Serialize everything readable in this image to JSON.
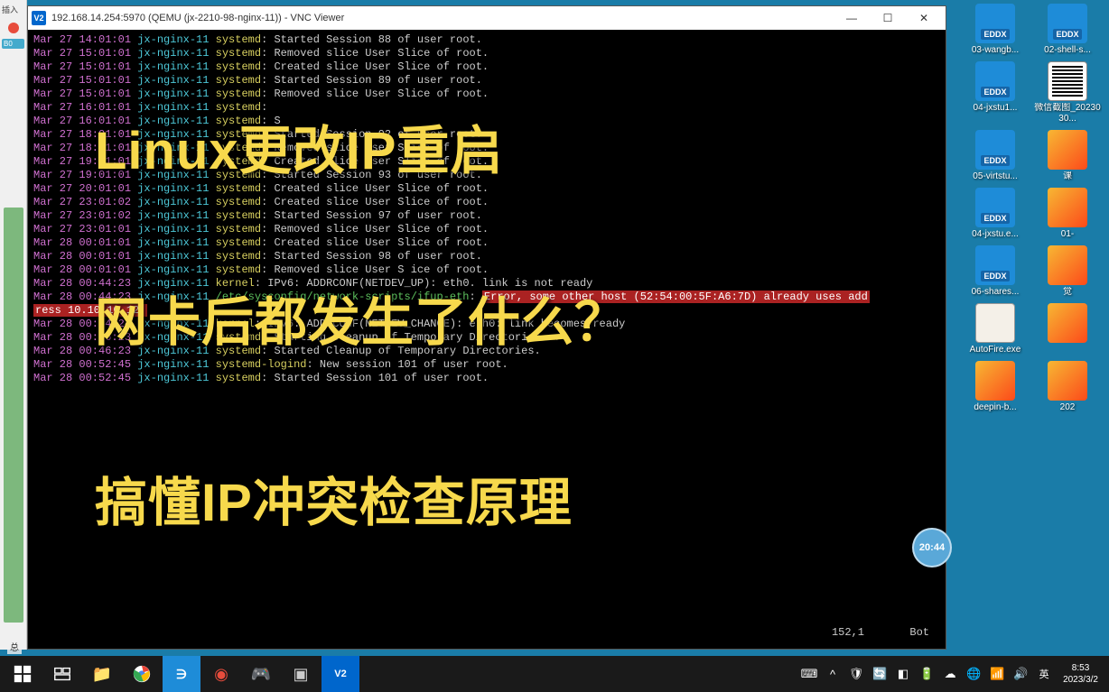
{
  "titlebar": {
    "icon": "V2",
    "title": "192.168.14.254:5970 (QEMU (jx-2210-98-nginx-11)) - VNC Viewer"
  },
  "terminal": {
    "lines": [
      {
        "d": "Mar 27 14:01:01",
        "h": "jx-nginx-11",
        "s": "systemd",
        "m": ": Started Session 88 of user root."
      },
      {
        "d": "Mar 27 15:01:01",
        "h": "jx-nginx-11",
        "s": "systemd",
        "m": ": Removed slice User Slice of root."
      },
      {
        "d": "Mar 27 15:01:01",
        "h": "jx-nginx-11",
        "s": "systemd",
        "m": ": Created slice User Slice of root."
      },
      {
        "d": "Mar 27 15:01:01",
        "h": "jx-nginx-11",
        "s": "systemd",
        "m": ": Started Session 89 of user root."
      },
      {
        "d": "Mar 27 15:01:01",
        "h": "jx-nginx-11",
        "s": "systemd",
        "m": ": Removed slice User Slice of root."
      },
      {
        "d": "Mar 27 16:01:01",
        "h": "jx-nginx-11",
        "s": "systemd",
        "m": ": "
      },
      {
        "d": "Mar 27 16:01:01",
        "h": "jx-nginx-11",
        "s": "systemd",
        "m": ": S"
      },
      {
        "d": "Mar 27 18:01:01",
        "h": "jx-nginx-11",
        "s": "systemd",
        "m": ": Started Session 92 of user root."
      },
      {
        "d": "Mar 27 18:01:01",
        "h": "jx-nginx-11",
        "s": "systemd",
        "m": ": Removed slice User Slice of root."
      },
      {
        "d": "Mar 27 19:01:01",
        "h": "jx-nginx-11",
        "s": "systemd",
        "m": ": Created slice User Slice of root."
      },
      {
        "d": "Mar 27 19:01:01",
        "h": "jx-nginx-11",
        "s": "systemd",
        "m": ": Started Session 93 of user root."
      },
      {
        "d": "Mar 27 20:01:01",
        "h": "jx-nginx-11",
        "s": "systemd",
        "m": ": Created slice User Slice of root."
      },
      {
        "d": "Mar 27 23:01:02",
        "h": "jx-nginx-11",
        "s": "systemd",
        "m": ": Created slice User Slice of root."
      },
      {
        "d": "Mar 27 23:01:02",
        "h": "jx-nginx-11",
        "s": "systemd",
        "m": ": Started Session 97 of user root."
      },
      {
        "d": "Mar 27 23:01:01",
        "h": "jx-nginx-11",
        "s": "systemd",
        "m": ": Removed slice User Slice of root."
      },
      {
        "d": "Mar 28 00:01:01",
        "h": "jx-nginx-11",
        "s": "systemd",
        "m": ": Created slice User Slice of root."
      },
      {
        "d": "Mar 28 00:01:01",
        "h": "jx-nginx-11",
        "s": "systemd",
        "m": ": Started Session 98 of user root."
      },
      {
        "d": "Mar 28 00:01:01",
        "h": "jx-nginx-11",
        "s": "systemd",
        "m": ": Removed slice User S ice of root."
      }
    ],
    "kernel1": "IPv6: ADDRCONF(NETDEV_UP): eth0. link is not ready",
    "ifup_path": "/etc/sysconfig/network-scripts/ifup-eth",
    "error1": "Error, some other host (52:54:00:5F:A6:7D) already uses add",
    "error2": "ress 10.10.10.12.",
    "post_lines": [
      {
        "d": "Mar 28 00:44:24",
        "h": "jx-nginx-11",
        "s": "kernel",
        "m": ": IPv6: ADDRCONF(NETDEV_CHANGE): eth0: link becomes ready"
      },
      {
        "d": "Mar 28 00:46:23",
        "h": "jx-nginx-11",
        "s": "systemd",
        "m": ": Starting Cleanup of Temporary Directories..."
      },
      {
        "d": "Mar 28 00:46:23",
        "h": "jx-nginx-11",
        "s": "systemd",
        "m": ": Started Cleanup of Temporary Directories."
      },
      {
        "d": "Mar 28 00:52:45",
        "h": "jx-nginx-11",
        "s": "systemd-logind",
        "m": ": New session 101 of user root."
      },
      {
        "d": "Mar 28 00:52:45",
        "h": "jx-nginx-11",
        "s": "systemd",
        "m": ": Started Session 101 of user root."
      }
    ],
    "footer_pos": "152,1",
    "footer_bot": "Bot"
  },
  "overlays": {
    "line1": "Linux更改IP重启",
    "line2": "网卡后都发生了什么？",
    "line3": "搞懂IP冲突检查原理"
  },
  "time_badge": "20:44",
  "desktop": [
    {
      "label": "03-wangb...",
      "type": "eddx"
    },
    {
      "label": "02-shell-s...",
      "type": "eddx"
    },
    {
      "label": "04-jxstu1...",
      "type": "eddx"
    },
    {
      "label": "微信截图_2023030...",
      "type": "qr"
    },
    {
      "label": "05-virtstu...",
      "type": "eddx"
    },
    {
      "label": "课",
      "type": "folder"
    },
    {
      "label": "04-jxstu.e...",
      "type": "eddx"
    },
    {
      "label": "01-",
      "type": "folder"
    },
    {
      "label": "06-shares...",
      "type": "eddx"
    },
    {
      "label": "觉",
      "type": "folder"
    },
    {
      "label": "AutoFire.exe",
      "type": "exe"
    },
    {
      "label": "",
      "type": "folder"
    },
    {
      "label": "deepin-b...",
      "type": "folder"
    },
    {
      "label": "202",
      "type": "folder"
    }
  ],
  "left_strip": {
    "tag": "插入",
    "badge": "B0"
  },
  "bottom_label": "总",
  "taskbar": {
    "lang": "英",
    "time": "8:53",
    "date": "2023/3/2"
  }
}
